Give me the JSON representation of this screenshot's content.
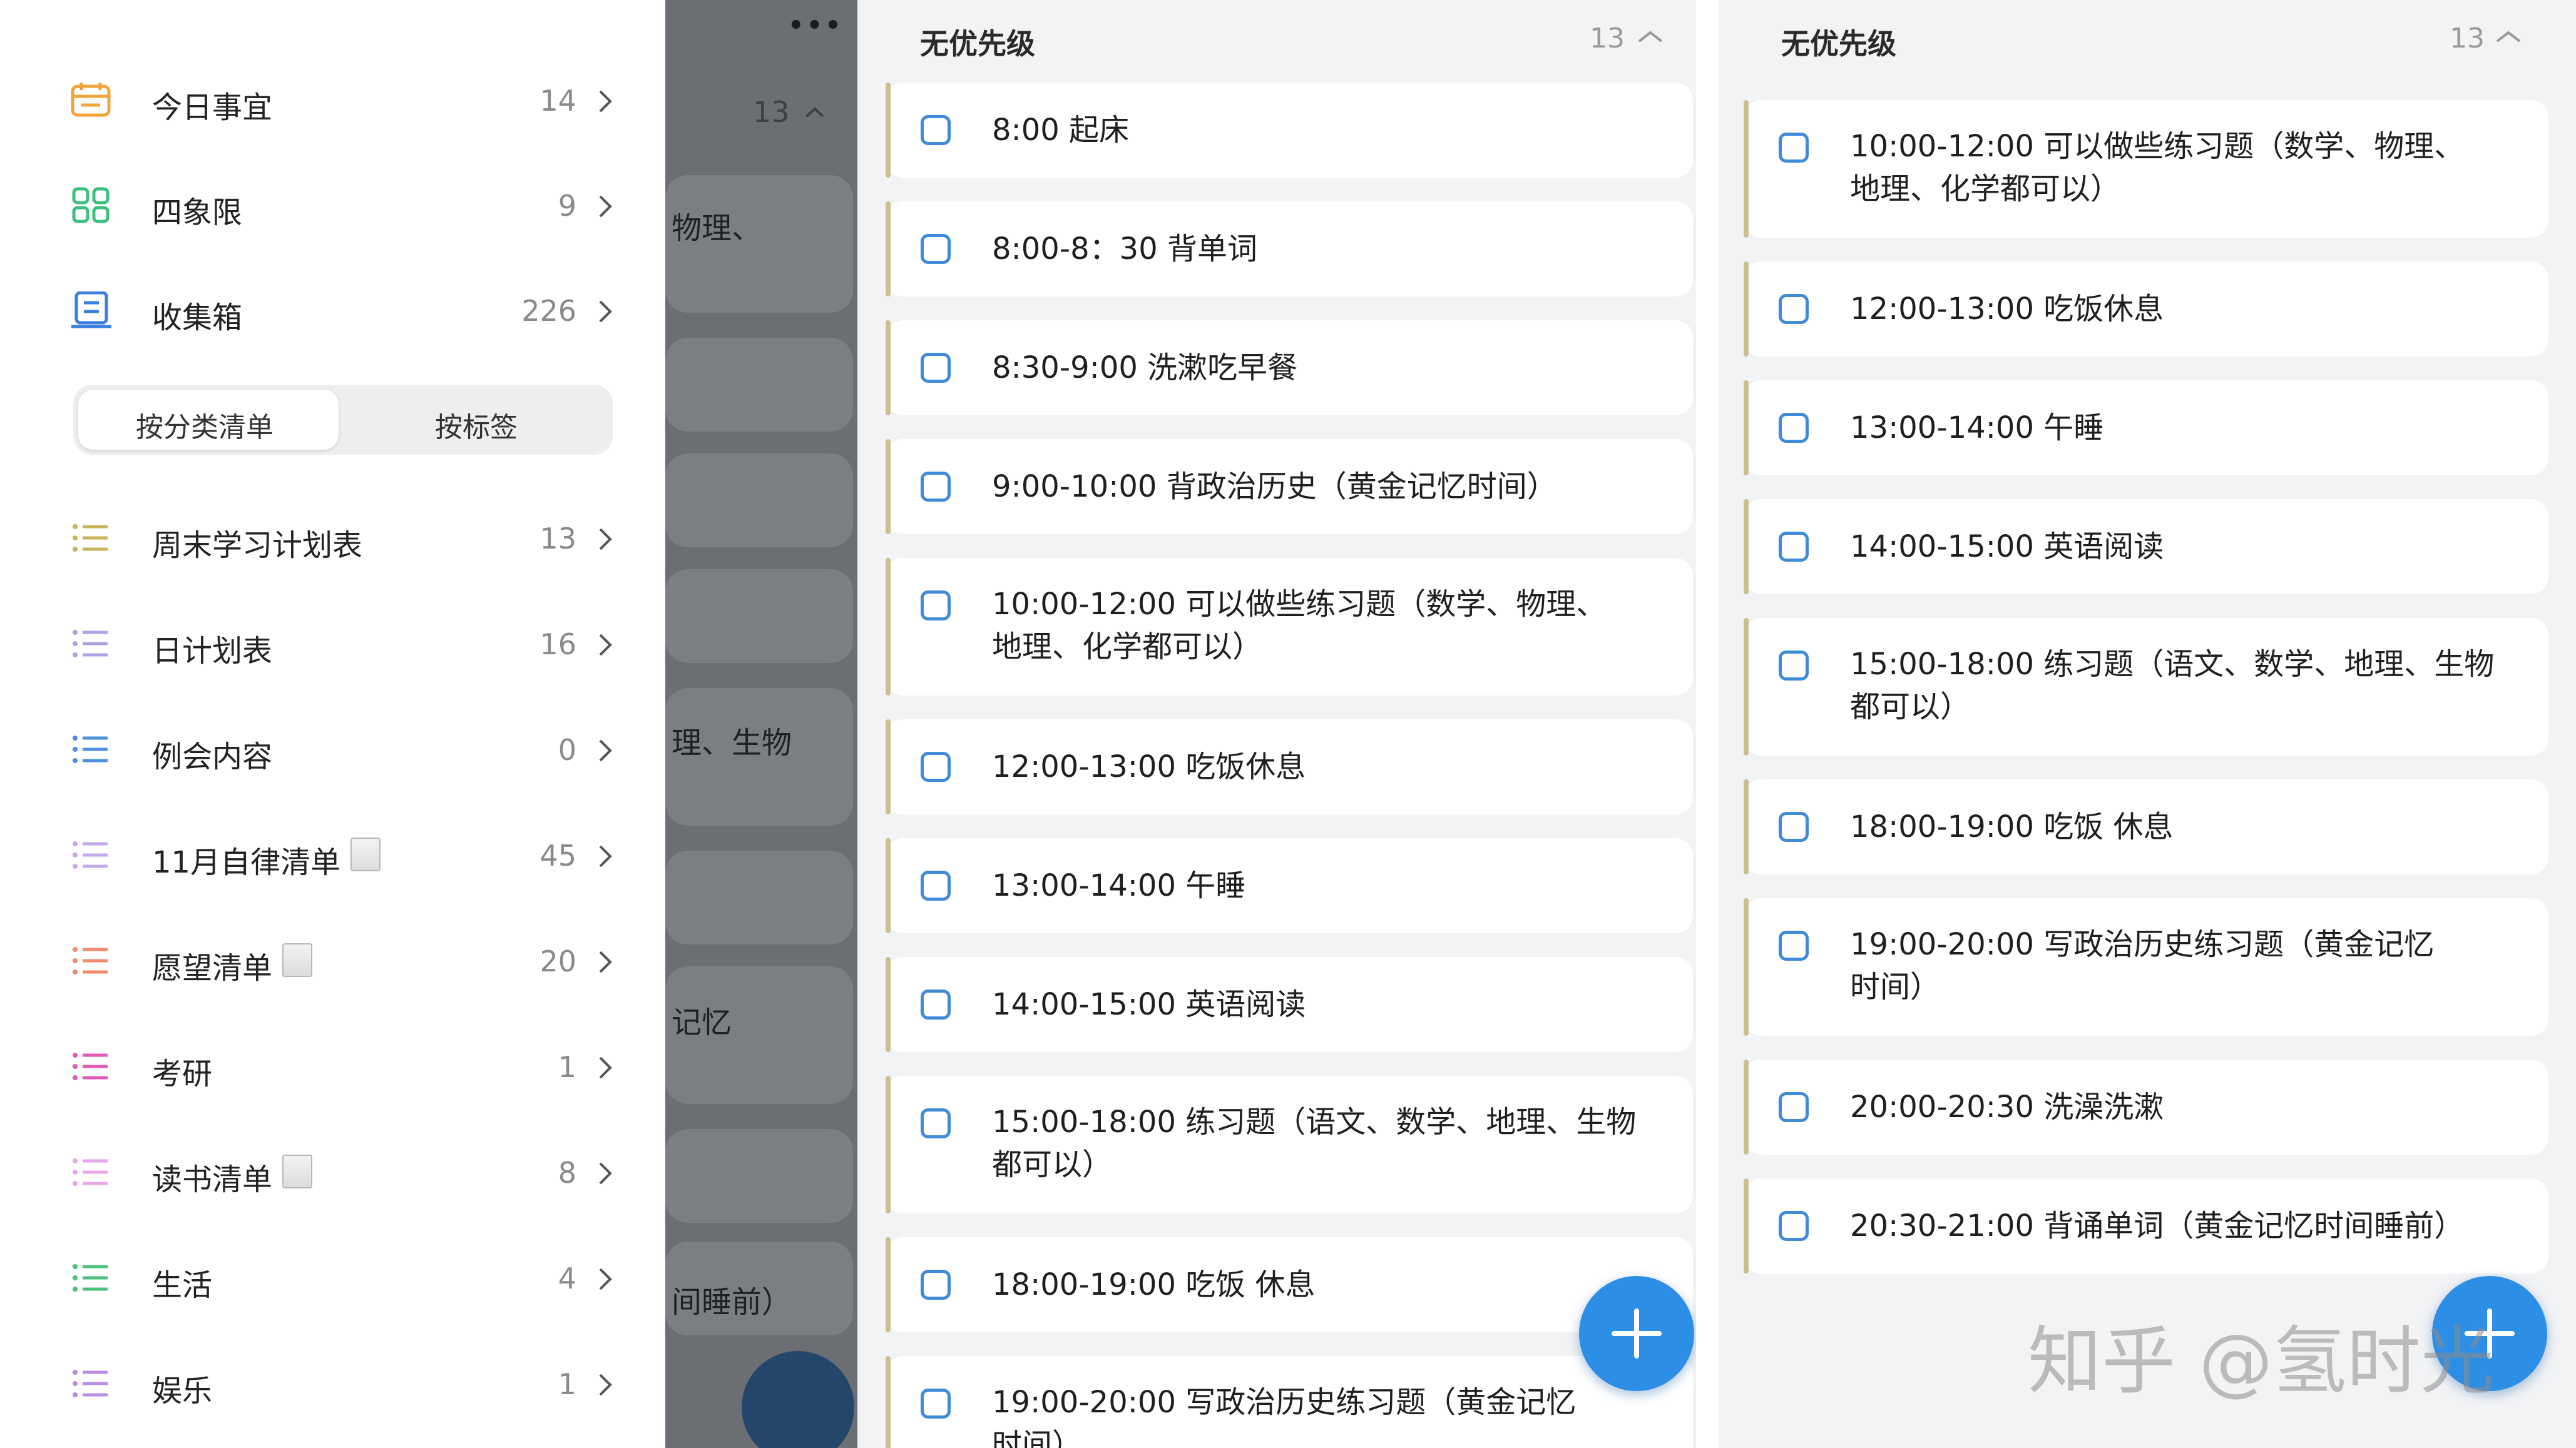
{
  "sidebar": {
    "top_items": [
      {
        "label": "今日事宜",
        "count": "14",
        "icon": "calendar-icon"
      },
      {
        "label": "四象限",
        "count": "9",
        "icon": "quadrant-grid-icon"
      },
      {
        "label": "收集箱",
        "count": "226",
        "icon": "inbox-icon"
      }
    ],
    "segment": {
      "left": "按分类清单",
      "right": "按标签",
      "selected": "按分类清单"
    },
    "lists": [
      {
        "label": "周末学习计划表",
        "count": "13",
        "color": "#c8b45a"
      },
      {
        "label": "日计划表",
        "count": "16",
        "color": "#a9a4e6"
      },
      {
        "label": "例会内容",
        "count": "0",
        "color": "#4a8fe0"
      },
      {
        "label": "11月自律清单",
        "count": "45",
        "color": "#c7a8ef"
      },
      {
        "label": "愿望清单",
        "count": "20",
        "color": "#f08a6a"
      },
      {
        "label": "考研",
        "count": "1",
        "color": "#e05ab6"
      },
      {
        "label": "读书清单",
        "count": "8",
        "color": "#e9a6ea"
      },
      {
        "label": "生活",
        "count": "4",
        "color": "#4bc07a"
      },
      {
        "label": "娱乐",
        "count": "1",
        "color": "#b78be6"
      }
    ]
  },
  "dim_panel": {
    "count": "13",
    "fragments": [
      "物理、",
      "理、生物",
      "记忆",
      "间睡前）"
    ]
  },
  "panel_a": {
    "section_title": "无优先级",
    "count": "13",
    "tasks": [
      {
        "lines": [
          "8:00 起床"
        ]
      },
      {
        "lines": [
          "8:00-8：30 背单词"
        ]
      },
      {
        "lines": [
          "8:30-9:00 洗漱吃早餐"
        ]
      },
      {
        "lines": [
          "9:00-10:00 背政治历史（黄金记忆时间）"
        ]
      },
      {
        "lines": [
          "10:00-12:00 可以做些练习题（数学、物理、",
          "地理、化学都可以）"
        ]
      },
      {
        "lines": [
          "12:00-13:00 吃饭休息"
        ]
      },
      {
        "lines": [
          "13:00-14:00 午睡"
        ]
      },
      {
        "lines": [
          "14:00-15:00 英语阅读"
        ]
      },
      {
        "lines": [
          "15:00-18:00 练习题（语文、数学、地理、生物",
          "都可以）"
        ]
      },
      {
        "lines": [
          "18:00-19:00 吃饭 休息"
        ]
      },
      {
        "lines": [
          "19:00-20:00 写政治历史练习题（黄金记忆",
          "时间）"
        ]
      }
    ]
  },
  "panel_b": {
    "section_title": "无优先级",
    "count": "13",
    "tasks": [
      {
        "lines": [
          "10:00-12:00 可以做些练习题（数学、物理、",
          "地理、化学都可以）"
        ]
      },
      {
        "lines": [
          "12:00-13:00 吃饭休息"
        ]
      },
      {
        "lines": [
          "13:00-14:00 午睡"
        ]
      },
      {
        "lines": [
          "14:00-15:00 英语阅读"
        ]
      },
      {
        "lines": [
          "15:00-18:00 练习题（语文、数学、地理、生物",
          "都可以）"
        ]
      },
      {
        "lines": [
          "18:00-19:00 吃饭 休息"
        ]
      },
      {
        "lines": [
          "19:00-20:00 写政治历史练习题（黄金记忆",
          "时间）"
        ]
      },
      {
        "lines": [
          "20:00-20:30 洗澡洗漱"
        ]
      },
      {
        "lines": [
          "20:30-21:00 背诵单词（黄金记忆时间睡前）"
        ]
      }
    ]
  },
  "watermark": "知乎 @氢时光",
  "colors": {
    "accent": "#2d8ee6",
    "checkbox": "#3f8bd8",
    "list_bar": "#c9c08e",
    "panel_bg": "#f2f3f5"
  }
}
